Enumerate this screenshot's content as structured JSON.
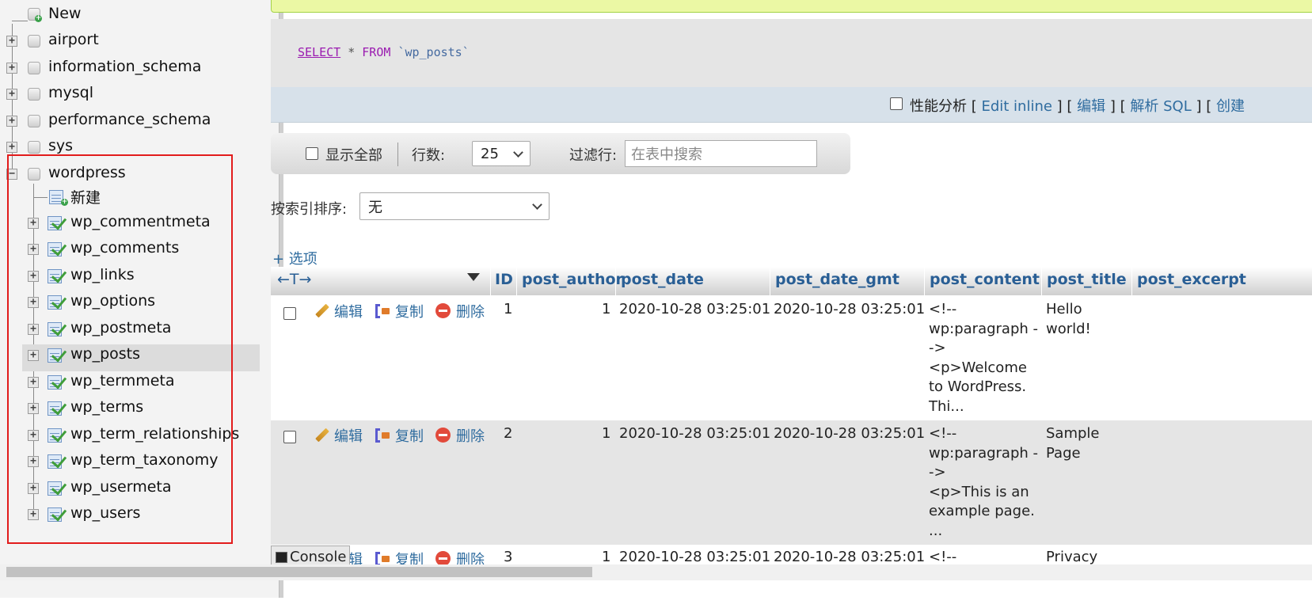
{
  "nav": {
    "new_label": "New",
    "databases": [
      "airport",
      "information_schema",
      "mysql",
      "performance_schema",
      "sys",
      "wordpress"
    ],
    "wordpress_new_label": "新建",
    "tables": [
      "wp_commentmeta",
      "wp_comments",
      "wp_links",
      "wp_options",
      "wp_postmeta",
      "wp_posts",
      "wp_termmeta",
      "wp_terms",
      "wp_term_relationships",
      "wp_term_taxonomy",
      "wp_usermeta",
      "wp_users"
    ],
    "selected_table": "wp_posts",
    "expand_symbol": "+",
    "collapse_symbol": "−"
  },
  "query": {
    "select_kw": "SELECT",
    "star": " * ",
    "from_kw": "FROM",
    "table": "`wp_posts`"
  },
  "sql_links": {
    "profile_label": "性能分析",
    "open": " [ ",
    "close": " ]",
    "edit_inline": "Edit inline",
    "edit": "编辑",
    "explain": "解析 SQL",
    "create": "创建"
  },
  "navigation_bar": {
    "show_all_label": "显示全部",
    "rows_label": "行数:",
    "rows_value": "25",
    "filter_label": "过滤行:",
    "filter_placeholder": "在表中搜索"
  },
  "sort": {
    "label": "按索引排序:",
    "value": "无"
  },
  "options_link": "+ 选项",
  "table": {
    "arrows_label": "←T→",
    "columns": [
      "ID",
      "post_author",
      "post_date",
      "post_date_gmt",
      "post_content",
      "post_title",
      "post_excerpt"
    ],
    "action_labels": {
      "edit": "编辑",
      "copy": "复制",
      "delete": "删除"
    },
    "rows": [
      {
        "id": "1",
        "author": "1",
        "date": "2020-10-28 03:25:01",
        "date_gmt": "2020-10-28 03:25:01",
        "content": [
          "<!--",
          "wp:paragraph -",
          "->",
          "<p>Welcome",
          "to WordPress.",
          "Thi..."
        ],
        "title": [
          "Hello",
          "world!"
        ]
      },
      {
        "id": "2",
        "author": "1",
        "date": "2020-10-28 03:25:01",
        "date_gmt": "2020-10-28 03:25:01",
        "content": [
          "<!--",
          "wp:paragraph -",
          "->",
          "<p>This is an",
          "example page.",
          "..."
        ],
        "title": [
          "Sample",
          "Page"
        ]
      },
      {
        "id": "3",
        "author": "1",
        "date": "2020-10-28 03:25:01",
        "date_gmt": "2020-10-28 03:25:01",
        "content": [
          "<!--"
        ],
        "title": [
          "Privacy"
        ]
      }
    ]
  },
  "console_label": "Console",
  "colors": {
    "highlight_border": "#e21c1c",
    "link_blue": "#2f6c9f",
    "sql_keyword": "#9a1bb0",
    "success_bar": "#ebf8a4"
  }
}
